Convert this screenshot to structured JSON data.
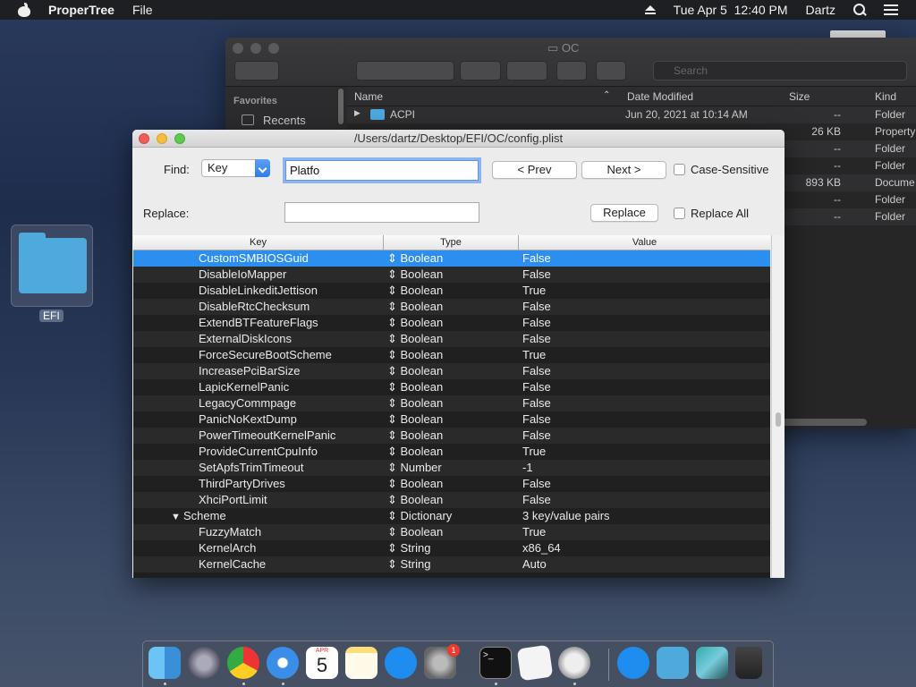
{
  "menubar": {
    "app_name": "ProperTree",
    "file_menu": "File",
    "datetime": "Tue Apr 5  12:40 PM",
    "user": "Dartz"
  },
  "finder": {
    "title": "OC",
    "search_placeholder": "Search",
    "sidebar_heading": "Favorites",
    "sidebar_recents": "Recents",
    "columns": {
      "name": "Name",
      "date": "Date Modified",
      "size": "Size",
      "kind": "Kind"
    },
    "rows": [
      {
        "name": "ACPI",
        "date": "Jun 20, 2021 at 10:14 AM",
        "size": "--",
        "kind": "Folder"
      },
      {
        "name": "",
        "date": "",
        "size": "26 KB",
        "kind": "Property"
      },
      {
        "name": "",
        "date": "",
        "size": "--",
        "kind": "Folder"
      },
      {
        "name": "",
        "date": "",
        "size": "--",
        "kind": "Folder"
      },
      {
        "name": "",
        "date": "",
        "size": "893 KB",
        "kind": "Docume"
      },
      {
        "name": "",
        "date": "",
        "size": "--",
        "kind": "Folder"
      },
      {
        "name": "",
        "date": "",
        "size": "--",
        "kind": "Folder"
      }
    ]
  },
  "desktop": {
    "folder_label": "EFI"
  },
  "window": {
    "title": "/Users/dartz/Desktop/EFI/OC/config.plist",
    "find_label": "Find:",
    "find_type": "Key",
    "find_value": "Platfo",
    "prev_label": "< Prev",
    "next_label": "Next >",
    "case_sensitive_label": "Case-Sensitive",
    "replace_label": "Replace:",
    "replace_value": "",
    "replace_button": "Replace",
    "replace_all_label": "Replace All"
  },
  "table": {
    "columns": {
      "key": "Key",
      "type": "Type",
      "value": "Value"
    },
    "rows": [
      {
        "key": "CustomSMBIOSGuid",
        "type": "⇕ Boolean",
        "value": "False",
        "indent": 1,
        "selected": true
      },
      {
        "key": "DisableIoMapper",
        "type": "⇕ Boolean",
        "value": "False",
        "indent": 1
      },
      {
        "key": "DisableLinkeditJettison",
        "type": "⇕ Boolean",
        "value": "True",
        "indent": 1
      },
      {
        "key": "DisableRtcChecksum",
        "type": "⇕ Boolean",
        "value": "False",
        "indent": 1
      },
      {
        "key": "ExtendBTFeatureFlags",
        "type": "⇕ Boolean",
        "value": "False",
        "indent": 1
      },
      {
        "key": "ExternalDiskIcons",
        "type": "⇕ Boolean",
        "value": "False",
        "indent": 1
      },
      {
        "key": "ForceSecureBootScheme",
        "type": "⇕ Boolean",
        "value": "True",
        "indent": 1
      },
      {
        "key": "IncreasePciBarSize",
        "type": "⇕ Boolean",
        "value": "False",
        "indent": 1
      },
      {
        "key": "LapicKernelPanic",
        "type": "⇕ Boolean",
        "value": "False",
        "indent": 1
      },
      {
        "key": "LegacyCommpage",
        "type": "⇕ Boolean",
        "value": "False",
        "indent": 1
      },
      {
        "key": "PanicNoKextDump",
        "type": "⇕ Boolean",
        "value": "False",
        "indent": 1
      },
      {
        "key": "PowerTimeoutKernelPanic",
        "type": "⇕ Boolean",
        "value": "False",
        "indent": 1
      },
      {
        "key": "ProvideCurrentCpuInfo",
        "type": "⇕ Boolean",
        "value": "True",
        "indent": 1
      },
      {
        "key": "SetApfsTrimTimeout",
        "type": "⇕ Number",
        "value": "-1",
        "indent": 1
      },
      {
        "key": "ThirdPartyDrives",
        "type": "⇕ Boolean",
        "value": "False",
        "indent": 1
      },
      {
        "key": "XhciPortLimit",
        "type": "⇕ Boolean",
        "value": "False",
        "indent": 1
      },
      {
        "key": "Scheme",
        "type": "⇕ Dictionary",
        "value": "3 key/value pairs",
        "indent": 0,
        "expanded": true,
        "toggle": "▼"
      },
      {
        "key": "FuzzyMatch",
        "type": "⇕ Boolean",
        "value": "True",
        "indent": 1
      },
      {
        "key": "KernelArch",
        "type": "⇕ String",
        "value": "x86_64",
        "indent": 1
      },
      {
        "key": "KernelCache",
        "type": "⇕ String",
        "value": "Auto",
        "indent": 1
      }
    ]
  },
  "dock": {
    "calendar_day": "5",
    "calendar_month": "APR",
    "settings_badge": "1",
    "terminal_prompt": ">_",
    "apps": [
      "finder-icon",
      "launchpad-icon",
      "chrome-icon",
      "safari-icon",
      "calendar-icon",
      "notes-icon",
      "app-store-icon",
      "system-preferences-icon",
      "terminal-icon",
      "textedit-icon",
      "propertree-icon",
      "app-store-download-icon",
      "folder-icon",
      "image-folder-icon",
      "trash-icon"
    ]
  },
  "colors": {
    "selection": "#2c8ff0",
    "menubar": "#1e1f22",
    "window_bg": "#ececec",
    "table_bg": "#1e1e1e"
  }
}
